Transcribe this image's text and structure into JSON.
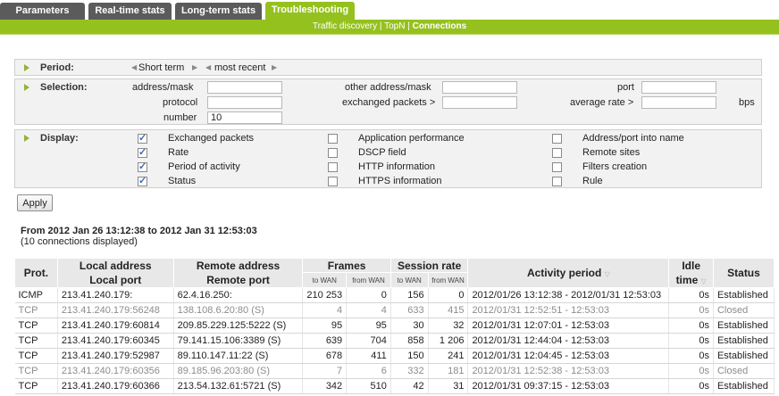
{
  "tabs": [
    "Parameters",
    "Real-time stats",
    "Long-term stats",
    "Troubleshooting"
  ],
  "subnav": {
    "items": [
      "Traffic discovery",
      "TopN",
      "Connections"
    ],
    "separator": " | "
  },
  "period": {
    "label": "Period:",
    "term": "Short term",
    "recency": "most recent"
  },
  "selection": {
    "label": "Selection:",
    "address_mask_label": "address/mask",
    "address_mask_value": "",
    "protocol_label": "protocol",
    "protocol_value": "",
    "number_label": "number",
    "number_value": "10",
    "other_address_label": "other address/mask",
    "other_address_value": "",
    "exchanged_packets_label": "exchanged packets >",
    "exchanged_packets_value": "",
    "port_label": "port",
    "port_value": "",
    "average_rate_label": "average rate >",
    "average_rate_value": "",
    "bps_label": "bps"
  },
  "display": {
    "label": "Display:",
    "col1": [
      {
        "label": "Exchanged packets",
        "checked": true
      },
      {
        "label": "Rate",
        "checked": true
      },
      {
        "label": "Period of activity",
        "checked": true
      },
      {
        "label": "Status",
        "checked": true
      }
    ],
    "col2": [
      {
        "label": "Application performance",
        "checked": false
      },
      {
        "label": "DSCP field",
        "checked": false
      },
      {
        "label": "HTTP information",
        "checked": false
      },
      {
        "label": "HTTPS information",
        "checked": false
      }
    ],
    "col3": [
      {
        "label": "Address/port into name",
        "checked": false
      },
      {
        "label": "Remote sites",
        "checked": false
      },
      {
        "label": "Filters creation",
        "checked": false
      },
      {
        "label": "Rule",
        "checked": false
      }
    ]
  },
  "apply_label": "Apply",
  "range_text": "From 2012 Jan 26 13:12:38 to 2012 Jan 31 12:53:03",
  "count_text": "(10 connections displayed)",
  "table": {
    "headers": {
      "prot": "Prot.",
      "local_top": "Local address",
      "local_bottom": "Local port",
      "remote_top": "Remote address",
      "remote_bottom": "Remote port",
      "frames": "Frames",
      "session_rate": "Session rate",
      "to_wan": "to WAN",
      "from_wan": "from WAN",
      "activity": "Activity period",
      "idle_top": "Idle",
      "idle_bottom": "time",
      "status": "Status"
    },
    "rows": [
      {
        "prot": "ICMP",
        "local": "213.41.240.179:",
        "remote": "62.4.16.250:",
        "f_to": "210 253",
        "f_from": "0",
        "r_to": "156",
        "r_from": "0",
        "period": "2012/01/26 13:12:38 - 2012/01/31 12:53:03",
        "idle": "0s",
        "status": "Established",
        "closed": false
      },
      {
        "prot": "TCP",
        "local": "213.41.240.179:56248",
        "remote": "138.108.6.20:80 (S)",
        "f_to": "4",
        "f_from": "4",
        "r_to": "633",
        "r_from": "415",
        "period": "2012/01/31 12:52:51 - 12:53:03",
        "idle": "0s",
        "status": "Closed",
        "closed": true
      },
      {
        "prot": "TCP",
        "local": "213.41.240.179:60814",
        "remote": "209.85.229.125:5222 (S)",
        "f_to": "95",
        "f_from": "95",
        "r_to": "30",
        "r_from": "32",
        "period": "2012/01/31 12:07:01 - 12:53:03",
        "idle": "0s",
        "status": "Established",
        "closed": false
      },
      {
        "prot": "TCP",
        "local": "213.41.240.179:60345",
        "remote": "79.141.15.106:3389 (S)",
        "f_to": "639",
        "f_from": "704",
        "r_to": "858",
        "r_from": "1 206",
        "period": "2012/01/31 12:44:04 - 12:53:03",
        "idle": "0s",
        "status": "Established",
        "closed": false
      },
      {
        "prot": "TCP",
        "local": "213.41.240.179:52987",
        "remote": "89.110.147.11:22 (S)",
        "f_to": "678",
        "f_from": "411",
        "r_to": "150",
        "r_from": "241",
        "period": "2012/01/31 12:04:45 - 12:53:03",
        "idle": "0s",
        "status": "Established",
        "closed": false
      },
      {
        "prot": "TCP",
        "local": "213.41.240.179:60356",
        "remote": "89.185.96.203:80 (S)",
        "f_to": "7",
        "f_from": "6",
        "r_to": "332",
        "r_from": "181",
        "period": "2012/01/31 12:52:38 - 12:53:03",
        "idle": "0s",
        "status": "Closed",
        "closed": true
      },
      {
        "prot": "TCP",
        "local": "213.41.240.179:60366",
        "remote": "213.54.132.61:5721 (S)",
        "f_to": "342",
        "f_from": "510",
        "r_to": "42",
        "r_from": "31",
        "period": "2012/01/31 09:37:15 - 12:53:03",
        "idle": "0s",
        "status": "Established",
        "closed": false
      }
    ]
  }
}
